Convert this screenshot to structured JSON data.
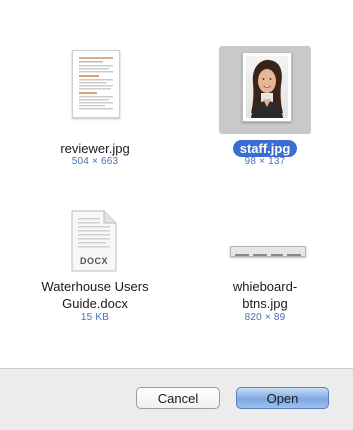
{
  "files": [
    {
      "name": "reviewer.jpg",
      "meta": "504 × 663",
      "selected": false
    },
    {
      "name": "staff.jpg",
      "meta": "98 × 137",
      "selected": true
    },
    {
      "name_line1": "Waterhouse Users",
      "name_line2": "Guide.docx",
      "meta": "15 KB",
      "badge": "DOCX",
      "selected": false
    },
    {
      "name_line1": "whieboard-",
      "name_line2": "btns.jpg",
      "meta": "820 × 89",
      "selected": false
    }
  ],
  "buttons": {
    "cancel_label": "Cancel",
    "open_label": "Open"
  },
  "colors": {
    "selection_pill": "#3a6ed2",
    "meta_text": "#4a6fb3",
    "default_button": "#7fa9e3"
  }
}
